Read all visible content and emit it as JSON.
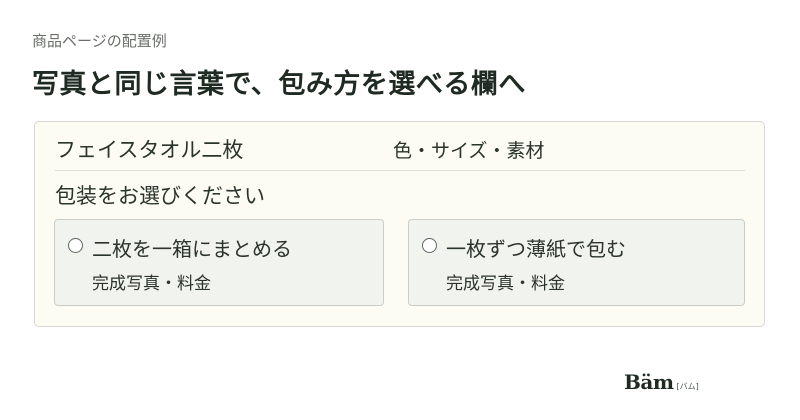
{
  "header": {
    "caption": "商品ページの配置例",
    "title": "写真と同じ言葉で、包み方を選べる欄へ"
  },
  "product": {
    "name": "フェイスタオル二枚",
    "attributes": "色・サイズ・素材"
  },
  "wrapping": {
    "question": "包装をお選びください",
    "options": [
      {
        "label": "二枚を一箱にまとめる",
        "note": "完成写真・料金",
        "selected": false
      },
      {
        "label": "一枚ずつ薄紙で包む",
        "note": "完成写真・料金",
        "selected": false
      }
    ]
  },
  "brand": {
    "logo_text": "Bäm",
    "logo_sub": "[バム]",
    "accent": "#5aa64a"
  }
}
